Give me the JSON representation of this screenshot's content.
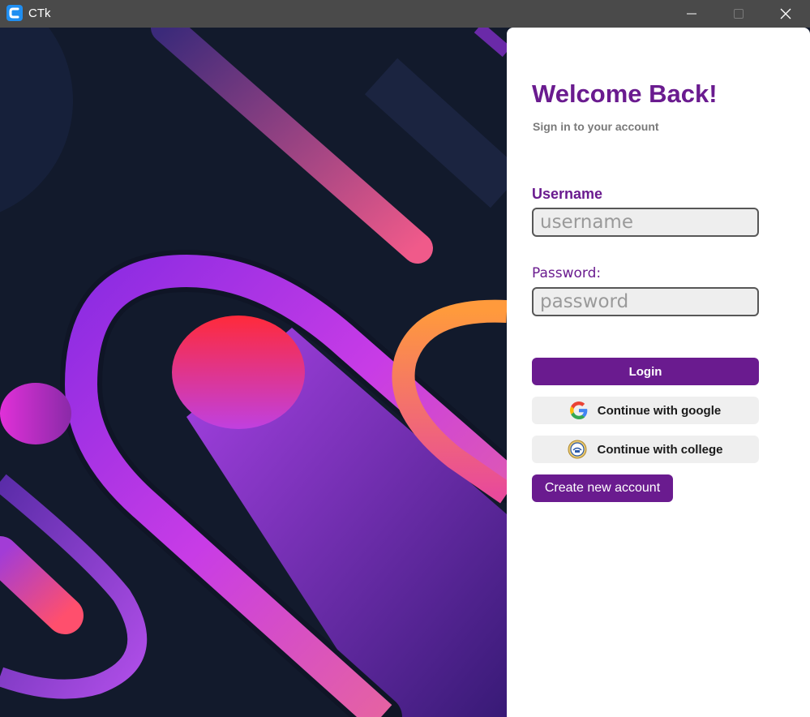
{
  "window": {
    "title": "CTk",
    "icon": "ctk-logo-icon",
    "controls": [
      "minimize-icon",
      "maximize-icon",
      "close-icon"
    ]
  },
  "artwork": {
    "description_icon": "abstract-shapes-artwork"
  },
  "login": {
    "heading": "Welcome Back!",
    "subtitle": "Sign in to your account",
    "username_label": "Username",
    "username_placeholder": "username",
    "username_value": "",
    "password_label": "Password:",
    "password_placeholder": "password",
    "password_value": "",
    "login_button": "Login",
    "google_button": "Continue with google",
    "college_button": "Continue with college",
    "create_button": "Create new account"
  },
  "colors": {
    "accent": "#6a1b8f",
    "titlebar": "#4a4a4a",
    "background_dark": "#121a2c",
    "field_bg": "#eeeeee"
  }
}
